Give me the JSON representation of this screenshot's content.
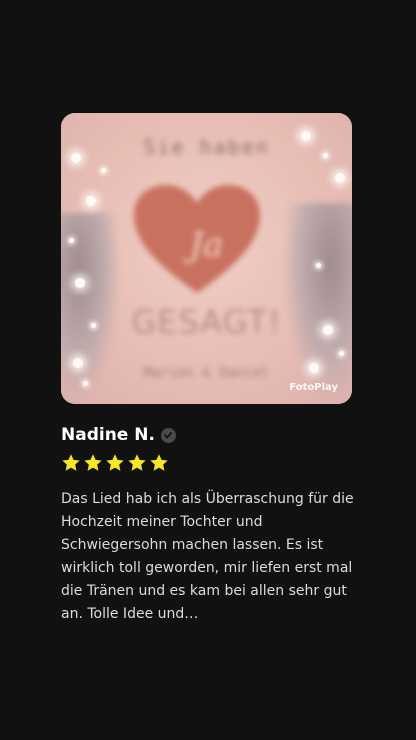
{
  "media": {
    "top_text": "Sie haben",
    "heart_text": "Ja",
    "headline": "GESAGT!",
    "names": "Marion & Daniel",
    "watermark": "FotoPlay"
  },
  "review": {
    "reviewer_name": "Nadine N.",
    "verified_icon": "check-badge-icon",
    "rating": 5,
    "rating_max": 5,
    "star_color": "#f5e626",
    "text": "Das Lied hab ich als Überraschung für die Hochzeit meiner Tochter und Schwiegersohn machen lassen.  Es ist wirklich toll geworden,  mir liefen erst mal die Tränen und es kam bei allen sehr gut an.  Tolle Idee und…"
  },
  "colors": {
    "background": "#121112",
    "media_bg": "#e9c3bb",
    "heart": "#c9715f"
  }
}
